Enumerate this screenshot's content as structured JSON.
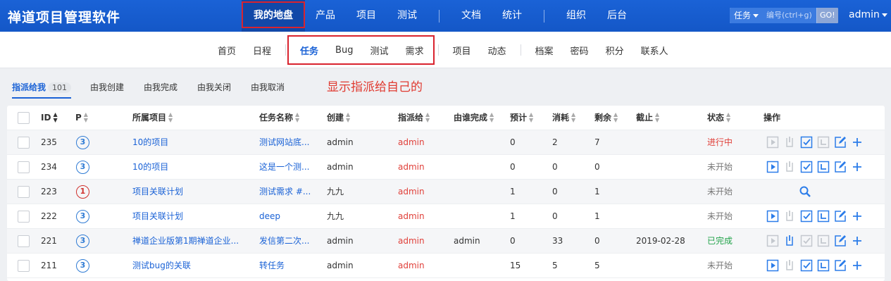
{
  "app": {
    "brand": "禅道项目管理软件"
  },
  "mainnav": {
    "items": [
      "我的地盘",
      "产品",
      "项目",
      "测试"
    ],
    "items2": [
      "文档",
      "统计"
    ],
    "items3": [
      "组织",
      "后台"
    ]
  },
  "search": {
    "type": "任务",
    "placeholder": "编号(ctrl+g)",
    "go": "GO!"
  },
  "user": {
    "name": "admin"
  },
  "subnav": {
    "group1": [
      "首页",
      "日程"
    ],
    "group2": [
      "任务",
      "Bug",
      "测试",
      "需求"
    ],
    "group3": [
      "项目",
      "动态"
    ],
    "group4": [
      "档案",
      "密码",
      "积分",
      "联系人"
    ]
  },
  "filters": {
    "tabs": [
      "指派给我",
      "由我创建",
      "由我完成",
      "由我关闭",
      "由我取消"
    ],
    "count": "101"
  },
  "annotation": "显示指派给自己的",
  "table": {
    "headers": [
      "ID",
      "P",
      "所属项目",
      "任务名称",
      "创建",
      "指派给",
      "由谁完成",
      "预计",
      "消耗",
      "剩余",
      "截止",
      "状态",
      "操作"
    ],
    "rows": [
      {
        "id": "235",
        "pri": "3",
        "project": "10的项目",
        "name": "测试网站底...",
        "creator": "admin",
        "assigned": "admin",
        "finished": "",
        "est": "0",
        "consumed": "2",
        "left": "7",
        "deadline": "",
        "status": "进行中",
        "status_kind": "doing",
        "actions": "full-disabled-start"
      },
      {
        "id": "234",
        "pri": "3",
        "project": "10的项目",
        "name": "这是一个测...",
        "creator": "admin",
        "assigned": "admin",
        "finished": "",
        "est": "0",
        "consumed": "0",
        "left": "0",
        "deadline": "",
        "status": "未开始",
        "status_kind": "wait",
        "actions": "full"
      },
      {
        "id": "223",
        "pri": "1",
        "project": "项目关联计划",
        "name": "测试需求 #...",
        "creator": "九九",
        "assigned": "admin",
        "finished": "",
        "est": "1",
        "consumed": "0",
        "left": "1",
        "deadline": "",
        "status": "未开始",
        "status_kind": "wait",
        "actions": "search"
      },
      {
        "id": "222",
        "pri": "3",
        "project": "项目关联计划",
        "name": "deep",
        "creator": "九九",
        "assigned": "admin",
        "finished": "",
        "est": "1",
        "consumed": "0",
        "left": "1",
        "deadline": "",
        "status": "未开始",
        "status_kind": "wait",
        "actions": "full"
      },
      {
        "id": "221",
        "pri": "3",
        "project": "禅道企业版第1期禅道企业...",
        "name": "发信第二次...",
        "creator": "admin",
        "assigned": "admin",
        "finished": "admin",
        "est": "0",
        "consumed": "33",
        "left": "0",
        "deadline": "2019-02-28",
        "status": "已完成",
        "status_kind": "done",
        "actions": "done"
      },
      {
        "id": "211",
        "pri": "3",
        "project": "测试bug的关联",
        "name": "转任务",
        "creator": "admin",
        "assigned": "admin",
        "finished": "",
        "est": "15",
        "consumed": "5",
        "left": "5",
        "deadline": "",
        "status": "未开始",
        "status_kind": "wait",
        "actions": "full"
      }
    ]
  },
  "colors": {
    "brand": "#1a62d6",
    "accent_red": "#e0403a",
    "done_green": "#22a34a"
  }
}
